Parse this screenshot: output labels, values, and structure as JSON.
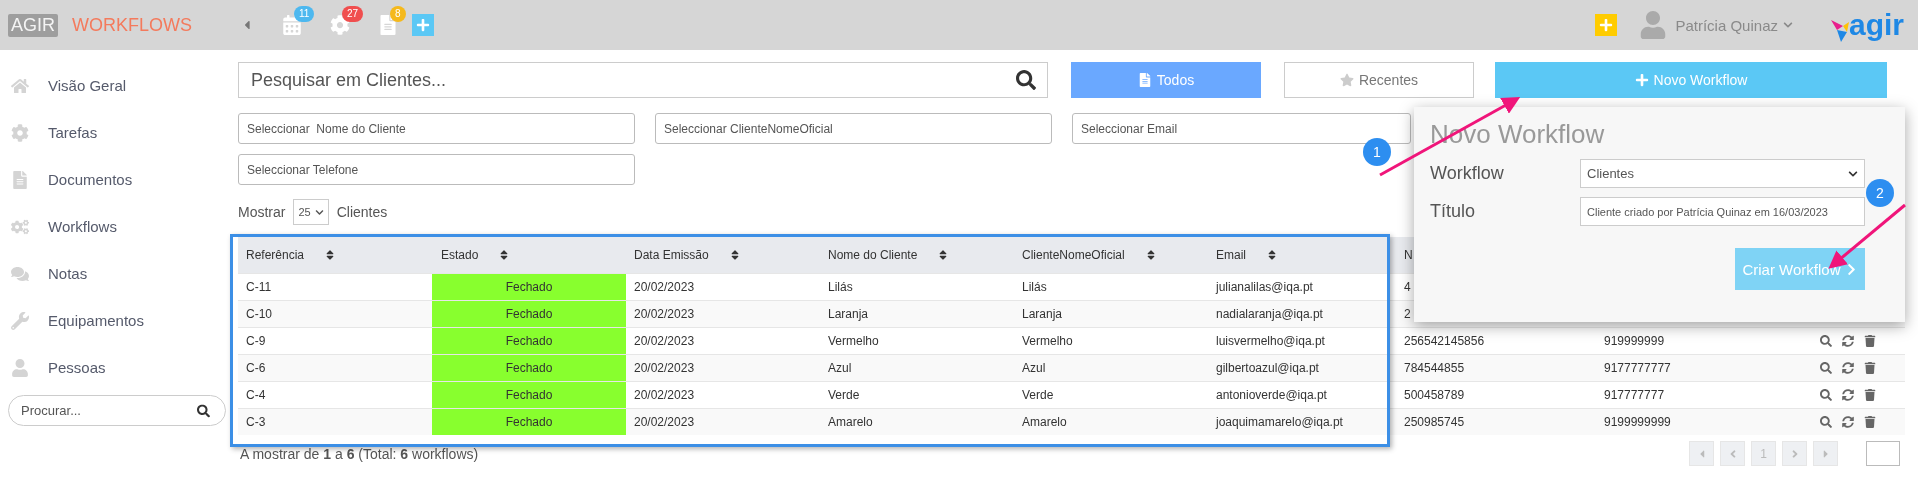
{
  "topbar": {
    "brand": "AGIR",
    "product": "WORKFLOWS",
    "badges": [
      {
        "count": "11",
        "color": "#4db8ef"
      },
      {
        "count": "27",
        "color": "#f04e4e"
      },
      {
        "count": "8",
        "color": "#f5b91c"
      }
    ],
    "user": "Patrícia Quinaz",
    "logo": "agir"
  },
  "sidebar": {
    "items": [
      {
        "label": "Visão Geral"
      },
      {
        "label": "Tarefas"
      },
      {
        "label": "Documentos"
      },
      {
        "label": "Workflows"
      },
      {
        "label": "Notas"
      },
      {
        "label": "Equipamentos"
      },
      {
        "label": "Pessoas"
      }
    ],
    "search": {
      "placeholder": "Procurar..."
    }
  },
  "search": {
    "placeholder": "Pesquisar em Clientes..."
  },
  "view_tabs": [
    {
      "label": "Todos",
      "selected": true
    },
    {
      "label": "Recentes",
      "selected": false
    }
  ],
  "new_button": "Novo Workflow",
  "filters": [
    {
      "placeholder": "Seleccionar  Nome do Cliente"
    },
    {
      "placeholder": "Seleccionar ClienteNomeOficial"
    },
    {
      "placeholder": "Seleccionar Email"
    },
    {
      "placeholder": "Seleccionar Telefone"
    }
  ],
  "page_size": {
    "label": "Mostrar",
    "value": "25",
    "unit": "Clientes"
  },
  "table": {
    "columns": [
      {
        "label": "Referência",
        "kind": "text"
      },
      {
        "label": "Estado",
        "kind": "status"
      },
      {
        "label": "Data Emissão",
        "kind": "text"
      },
      {
        "label": "Nome do Cliente",
        "kind": "text"
      },
      {
        "label": "ClienteNomeOficial",
        "kind": "text"
      },
      {
        "label": "Email",
        "kind": "text"
      },
      {
        "label": "N",
        "kind": "text"
      }
    ],
    "rows": [
      {
        "cells": [
          "C-11",
          "Fechado",
          "20/02/2023",
          "Lilás",
          "Lilás",
          "julianalilas@iqa.pt",
          "4"
        ]
      },
      {
        "cells": [
          "C-10",
          "Fechado",
          "20/02/2023",
          "Laranja",
          "Laranja",
          "nadialaranja@iqa.pt",
          "2"
        ]
      },
      {
        "cells": [
          "C-9",
          "Fechado",
          "20/02/2023",
          "Vermelho",
          "Vermelho",
          "luisvermelho@iqa.pt",
          "256542145856",
          "919999999"
        ]
      },
      {
        "cells": [
          "C-6",
          "Fechado",
          "20/02/2023",
          "Azul",
          "Azul",
          "gilbertoazul@iqa.pt",
          "784544855",
          "9177777777"
        ]
      },
      {
        "cells": [
          "C-4",
          "Fechado",
          "20/02/2023",
          "Verde",
          "Verde",
          "antonioverde@iqa.pt",
          "500458789",
          "917777777"
        ]
      },
      {
        "cells": [
          "C-3",
          "Fechado",
          "20/02/2023",
          "Amarelo",
          "Amarelo",
          "joaquimamarelo@iqa.pt",
          "250985745",
          "9199999999"
        ]
      }
    ]
  },
  "footer": {
    "text": "A mostrar de **1** a **6** (Total: **6** workflows)",
    "page": "1"
  },
  "popover": {
    "title": "Novo Workflow",
    "fields": [
      {
        "label": "Workflow",
        "kind": "select",
        "value": "Clientes"
      },
      {
        "label": "Título",
        "kind": "text",
        "value": "Cliente criado por Patrícia Quinaz em 16/03/2023"
      }
    ],
    "button": "Criar Workflow"
  },
  "annotations": [
    {
      "number": "1"
    },
    {
      "number": "2"
    }
  ]
}
